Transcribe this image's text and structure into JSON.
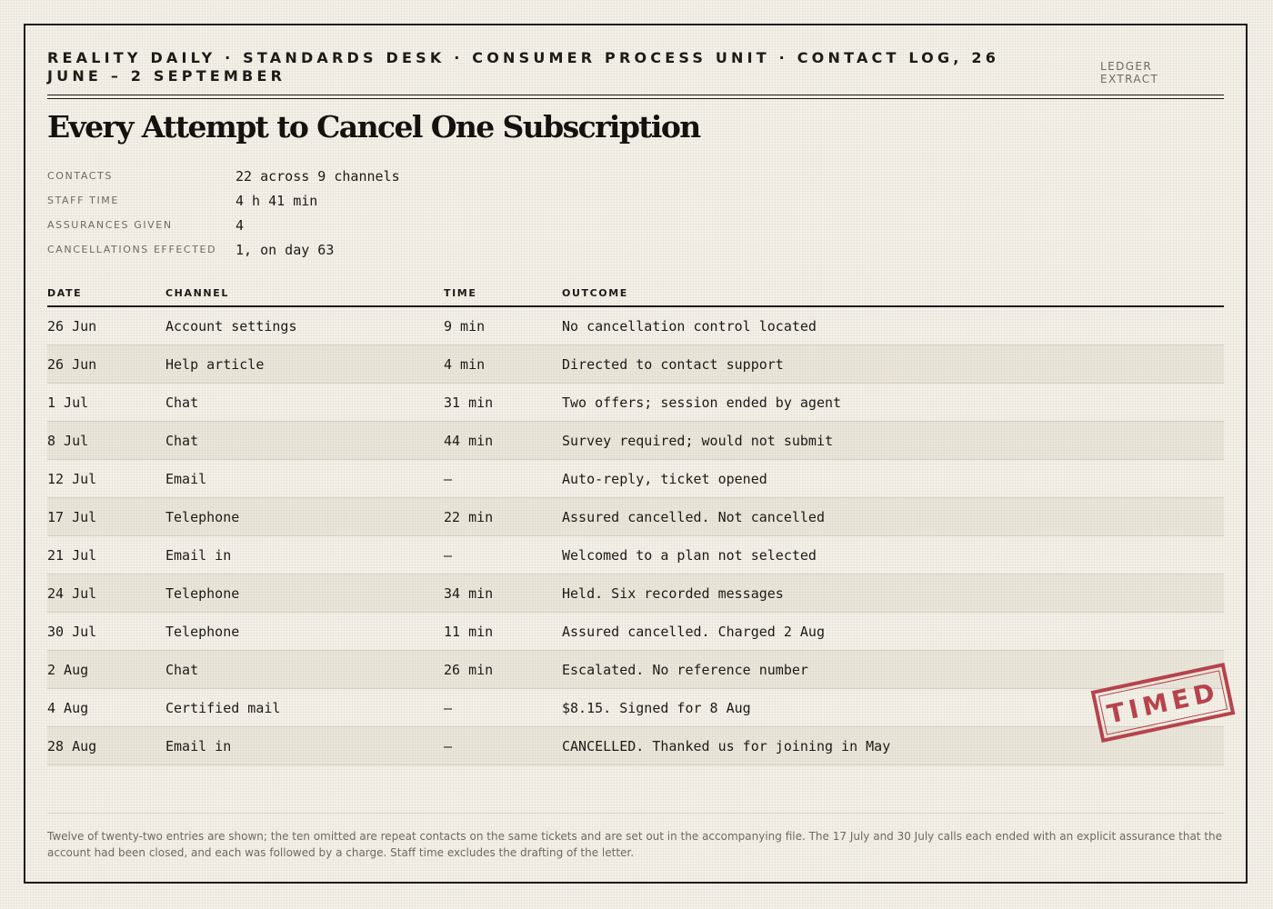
{
  "header": {
    "masthead": "Reality Daily · Standards Desk · Consumer Process Unit · Contact Log, 26 June – 2 September",
    "ledger_tag": "LEDGER EXTRACT",
    "title": "Every Attempt to Cancel One Subscription"
  },
  "summary": [
    {
      "label": "CONTACTS",
      "value": "22 across 9 channels"
    },
    {
      "label": "STAFF TIME",
      "value": "4 h 41 min"
    },
    {
      "label": "ASSURANCES GIVEN",
      "value": "4"
    },
    {
      "label": "CANCELLATIONS EFFECTED",
      "value": "1, on day 63"
    }
  ],
  "table": {
    "columns": [
      "DATE",
      "CHANNEL",
      "TIME",
      "OUTCOME"
    ],
    "rows": [
      {
        "date": "26 Jun",
        "channel": "Account settings",
        "time": "9 min",
        "outcome": "No cancellation control located"
      },
      {
        "date": "26 Jun",
        "channel": "Help article",
        "time": "4 min",
        "outcome": "Directed to contact support"
      },
      {
        "date": "1 Jul",
        "channel": "Chat",
        "time": "31 min",
        "outcome": "Two offers; session ended by agent"
      },
      {
        "date": "8 Jul",
        "channel": "Chat",
        "time": "44 min",
        "outcome": "Survey required; would not submit"
      },
      {
        "date": "12 Jul",
        "channel": "Email",
        "time": "—",
        "outcome": "Auto-reply, ticket opened"
      },
      {
        "date": "17 Jul",
        "channel": "Telephone",
        "time": "22 min",
        "outcome": "Assured cancelled. Not cancelled"
      },
      {
        "date": "21 Jul",
        "channel": "Email in",
        "time": "—",
        "outcome": "Welcomed to a plan not selected"
      },
      {
        "date": "24 Jul",
        "channel": "Telephone",
        "time": "34 min",
        "outcome": "Held. Six recorded messages"
      },
      {
        "date": "30 Jul",
        "channel": "Telephone",
        "time": "11 min",
        "outcome": "Assured cancelled. Charged 2 Aug"
      },
      {
        "date": "2 Aug",
        "channel": "Chat",
        "time": "26 min",
        "outcome": "Escalated. No reference number"
      },
      {
        "date": "4 Aug",
        "channel": "Certified mail",
        "time": "—",
        "outcome": "$8.15. Signed for 8 Aug"
      },
      {
        "date": "28 Aug",
        "channel": "Email in",
        "time": "—",
        "outcome": "CANCELLED. Thanked us for joining in May"
      }
    ]
  },
  "stamp": {
    "text": "TIMED",
    "color": "#b1323d"
  },
  "footnote": "Twelve of twenty-two entries are shown; the ten omitted are repeat contacts on the same tickets and are set out in the accompanying file. The 17 July and 30 July calls each ended with an explicit assurance that the account had been closed, and each was followed by a charge. Staff time excludes the drafting of the letter."
}
